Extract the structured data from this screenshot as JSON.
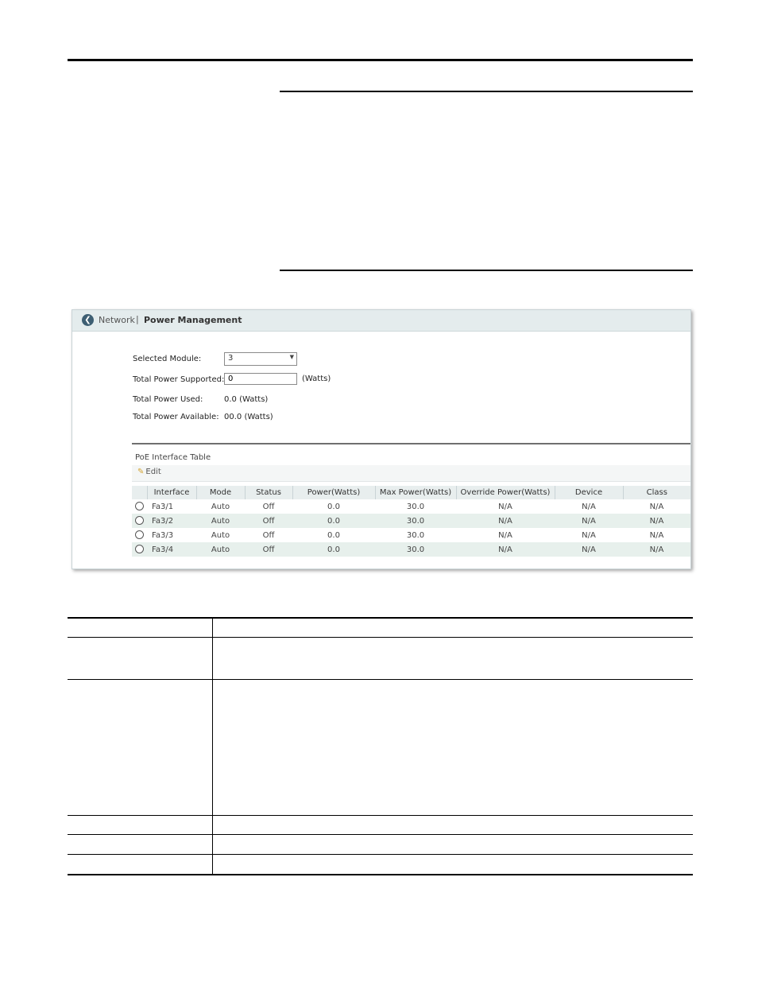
{
  "app": {
    "breadcrumb_parent": "Network",
    "breadcrumb_separator": "|",
    "page_title": "Power Management",
    "back_icon": "chevron-left-icon"
  },
  "form": {
    "selected_module_label": "Selected Module:",
    "selected_module_value": "3",
    "total_power_supported_label": "Total Power Supported:",
    "total_power_supported_value": "0",
    "total_power_supported_unit": "(Watts)",
    "total_power_used_label": "Total Power Used:",
    "total_power_used_value": "0.0 (Watts)",
    "total_power_available_label": "Total Power Available:",
    "total_power_available_value": "00.0 (Watts)"
  },
  "poe_table": {
    "title": "PoE Interface Table",
    "edit_label": "Edit",
    "columns": [
      "Interface",
      "Mode",
      "Status",
      "Power(Watts)",
      "Max Power(Watts)",
      "Override Power(Watts)",
      "Device",
      "Class"
    ],
    "rows": [
      [
        "Fa3/1",
        "Auto",
        "Off",
        "0.0",
        "30.0",
        "N/A",
        "N/A",
        "N/A"
      ],
      [
        "Fa3/2",
        "Auto",
        "Off",
        "0.0",
        "30.0",
        "N/A",
        "N/A",
        "N/A"
      ],
      [
        "Fa3/3",
        "Auto",
        "Off",
        "0.0",
        "30.0",
        "N/A",
        "N/A",
        "N/A"
      ],
      [
        "Fa3/4",
        "Auto",
        "Off",
        "0.0",
        "30.0",
        "N/A",
        "N/A",
        "N/A"
      ]
    ]
  }
}
